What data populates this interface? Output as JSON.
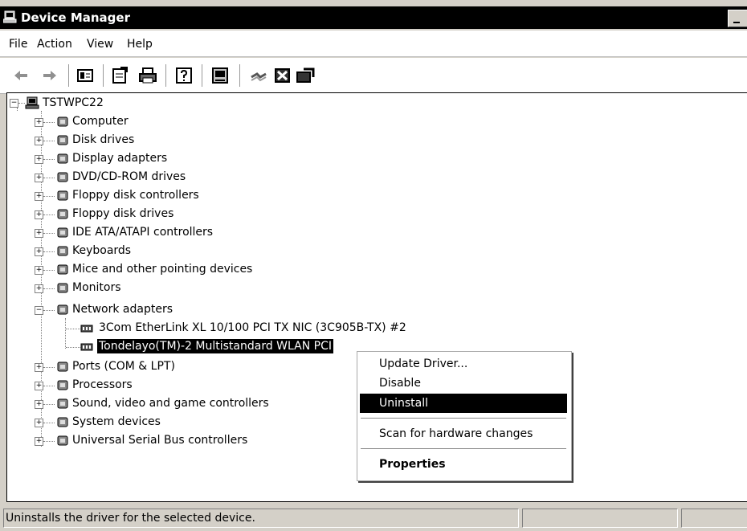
{
  "window": {
    "title": "Device Manager"
  },
  "menu": [
    "File",
    "Action",
    "View",
    "Help"
  ],
  "toolbar": {
    "icons": [
      "back-arrow-icon",
      "forward-arrow-icon",
      "show-hide-console-tree-icon",
      "properties-icon",
      "print-icon",
      "help-icon",
      "scan-hardware-icon",
      "uninstall-icon",
      "disable-icon",
      "update-driver-icon"
    ]
  },
  "tree": {
    "root": "TSTWPC22",
    "categories": [
      "Computer",
      "Disk drives",
      "Display adapters",
      "DVD/CD-ROM drives",
      "Floppy disk controllers",
      "Floppy disk drives",
      "IDE ATA/ATAPI controllers",
      "Keyboards",
      "Mice and other pointing devices",
      "Monitors",
      "Network adapters",
      "Ports (COM & LPT)",
      "Processors",
      "Sound, video and game controllers",
      "System devices",
      "Universal Serial Bus controllers"
    ],
    "network_children": [
      "3Com EtherLink XL 10/100 PCI TX NIC (3C905B-TX) #2",
      "Tondelayo(TM)-2 Multistandard WLAN PCI"
    ]
  },
  "context_menu": {
    "items": [
      "Update Driver...",
      "Disable",
      "Uninstall",
      "Scan for hardware changes",
      "Properties"
    ],
    "highlighted": "Uninstall"
  },
  "status": {
    "text": "Uninstalls the driver for the selected device."
  }
}
